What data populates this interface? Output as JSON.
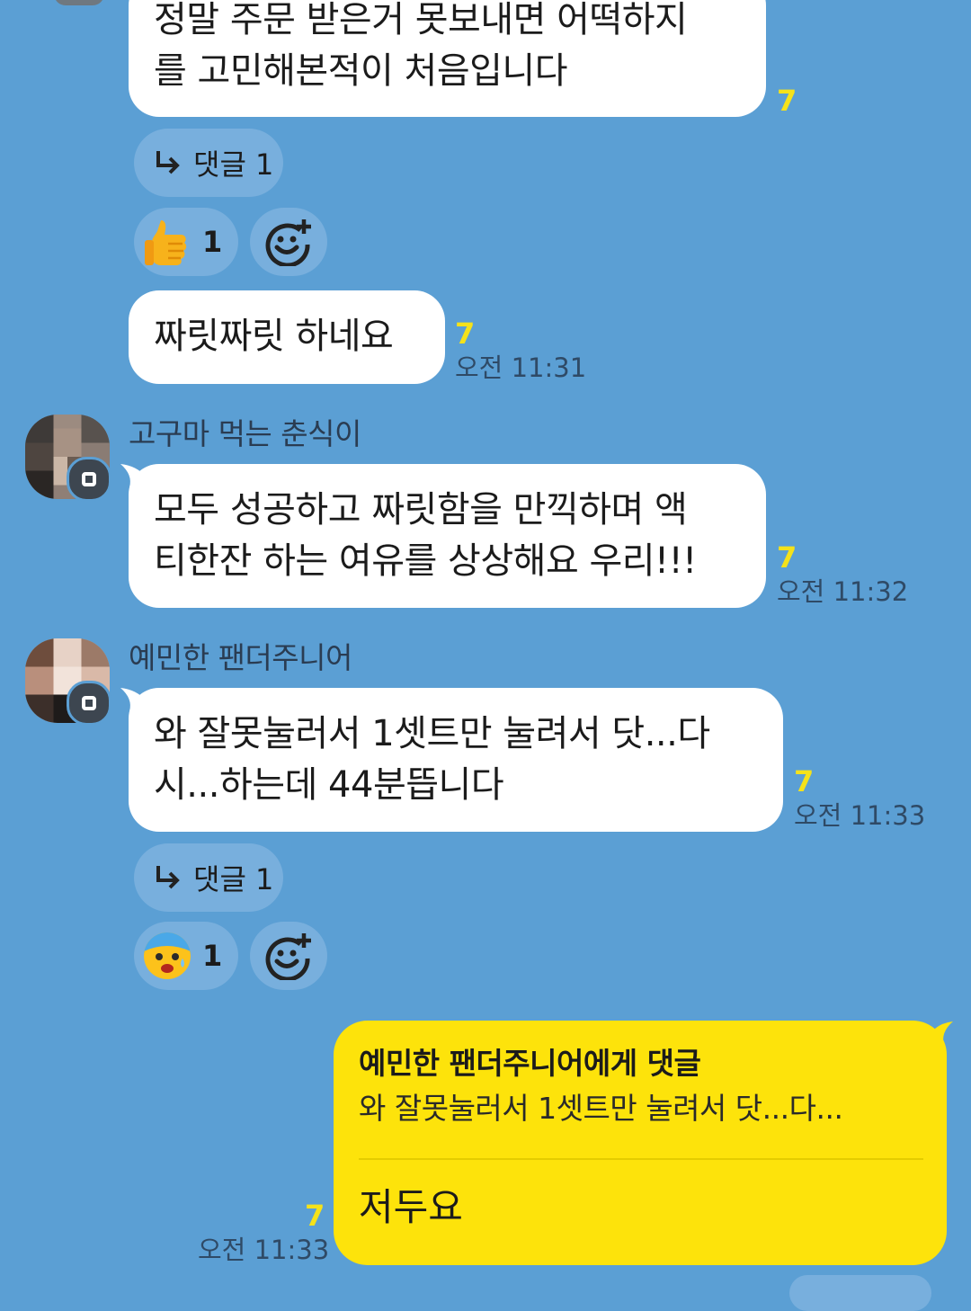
{
  "messages": {
    "m1": {
      "line1": "정말 주문 받은거 못보내면 어떡하지",
      "line2": "를 고민해본적이 처음입니다",
      "unread": "7"
    },
    "m1_reply": {
      "label": "댓글 1"
    },
    "m1_reaction": {
      "emoji": "thumbs-up",
      "count": "1"
    },
    "m2": {
      "text": "짜릿짜릿 하네요",
      "unread": "7",
      "time": "오전 11:31"
    },
    "m3": {
      "sender": "고구마 먹는 춘식이",
      "line1": "모두 성공하고 짜릿함을 만끽하며 액",
      "line2": "티한잔 하는 여유를 상상해요 우리!!!",
      "unread": "7",
      "time": "오전 11:32"
    },
    "m4": {
      "sender": "예민한 팬더주니어",
      "line1": "와 잘못눌러서 1셋트만 눌려서 닷...다",
      "line2": "시...하는데 44분뜹니다",
      "unread": "7",
      "time": "오전 11:33"
    },
    "m4_reply": {
      "label": "댓글 1"
    },
    "m4_reaction": {
      "emoji": "anxious-face",
      "count": "1"
    },
    "m5": {
      "reply_to": "예민한 팬더주니어에게 댓글",
      "quoted": "와 잘못눌러서 1셋트만 눌려서 닷...다...",
      "text": "저두요",
      "unread": "7",
      "time": "오전 11:33"
    }
  },
  "colors": {
    "background": "#5b9fd4",
    "my_bubble": "#fde30b",
    "unread": "#f5e21a"
  }
}
